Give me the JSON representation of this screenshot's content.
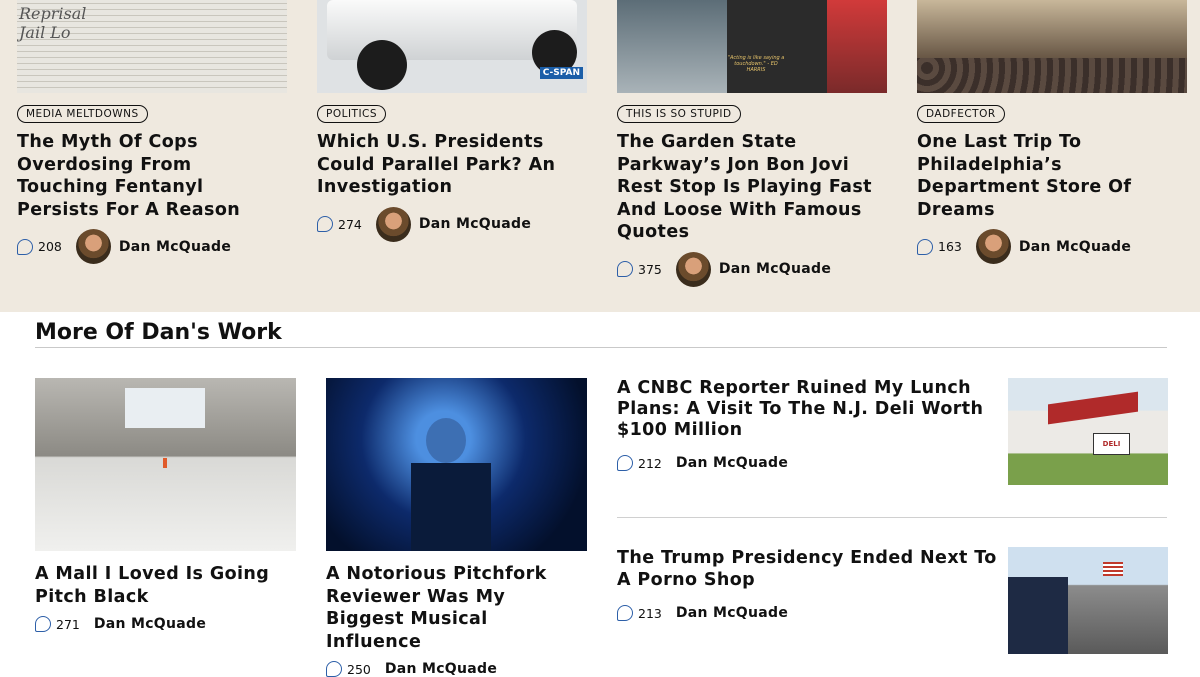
{
  "top_cards": [
    {
      "tag": "MEDIA MELTDOWNS",
      "title": "The Myth Of Cops Overdosing From Touching Fentanyl Persists For A Reason",
      "comments": "208",
      "author": "Dan McQuade",
      "thumb_label": "newspaper-clipping"
    },
    {
      "tag": "POLITICS",
      "title": "Which U.S. Presidents Could Parallel Park? An Investigation",
      "comments": "274",
      "author": "Dan McQuade",
      "thumb_label": "C-SPAN"
    },
    {
      "tag": "THIS IS SO STUPID",
      "title": "The Garden State Parkway’s Jon Bon Jovi Rest Stop Is Playing Fast And Loose With Famous Quotes",
      "comments": "375",
      "author": "Dan McQuade",
      "thumb_label": "\"Acting is like saying a touchdown.\" - ED HARRIS"
    },
    {
      "tag": "DADFECTOR",
      "title": "One Last Trip To Philadelphia’s Department Store Of Dreams",
      "comments": "163",
      "author": "Dan McQuade",
      "thumb_label": "crowd"
    }
  ],
  "more": {
    "heading": "More Of Dan's Work",
    "left_cards": [
      {
        "title": "A Mall I Loved Is Going Pitch Black",
        "comments": "271",
        "author": "Dan McQuade"
      },
      {
        "title": "A Notorious Pitchfork Reviewer Was My Biggest Musical Influence",
        "comments": "250",
        "author": "Dan McQuade"
      }
    ],
    "right_items": [
      {
        "title": "A CNBC Reporter Ruined My Lunch Plans: A Visit To The N.J. Deli Worth $100 Million",
        "comments": "212",
        "author": "Dan McQuade",
        "thumb_sign": "DELI"
      },
      {
        "title": "The Trump Presidency Ended Next To A Porno Shop",
        "comments": "213",
        "author": "Dan McQuade"
      }
    ]
  },
  "colors": {
    "band": "#efe9df",
    "accent": "#2d5fa8"
  }
}
